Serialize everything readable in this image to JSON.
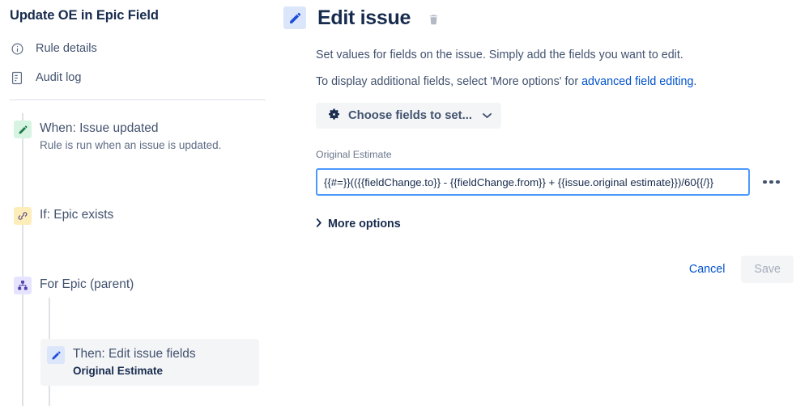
{
  "sidebar": {
    "rule_title": "Update OE in Epic Field",
    "nav": [
      {
        "label": "Rule details",
        "icon": "info-circle-icon"
      },
      {
        "label": "Audit log",
        "icon": "document-icon"
      }
    ],
    "tree": [
      {
        "kind": "trigger",
        "title": "When: Issue updated",
        "subtitle": "Rule is run when an issue is updated.",
        "icon": "pencil-icon",
        "chip_color": "#d7f4e3"
      },
      {
        "kind": "condition",
        "title": "If: Epic exists",
        "subtitle": "",
        "icon": "link-icon",
        "chip_color": "#fdeeb9"
      },
      {
        "kind": "branch",
        "title": "For Epic (parent)",
        "subtitle": "",
        "icon": "org-chart-icon",
        "chip_color": "#e6e3ff"
      },
      {
        "kind": "action",
        "title": "Then: Edit issue fields",
        "subtitle": "Original Estimate",
        "icon": "pencil-icon",
        "chip_color": "#dce6fb",
        "selected": true
      }
    ]
  },
  "main": {
    "icon": "pencil-icon",
    "title": "Edit issue",
    "delete_icon": "trash-icon",
    "description_line_1": "Set values for fields on the issue. Simply add the fields you want to edit.",
    "description_line_2_prefix": "To display additional fields, select 'More options' for ",
    "description_line_2_link": "advanced field editing",
    "description_line_2_suffix": ".",
    "choose_fields": {
      "label": "Choose fields to set...",
      "icon": "gear-icon",
      "chevron": "chevron-down-icon"
    },
    "field": {
      "label": "Original Estimate",
      "value": "{{#=}}(({{fieldChange.to}} - {{fieldChange.from}} + {{issue.original estimate}})/60{{/}}",
      "placeholder": "",
      "more_menu_icon": "ellipsis-icon"
    },
    "more_options": {
      "label": "More options",
      "icon": "chevron-right-icon",
      "expanded": false
    },
    "cancel_label": "Cancel",
    "save_label": "Save",
    "save_disabled": true
  },
  "colors": {
    "link": "#0052cc",
    "text": "#172b4d",
    "muted": "#5e6c84",
    "focus_border": "#4c9aff",
    "panel_bg": "#f4f5f7"
  }
}
